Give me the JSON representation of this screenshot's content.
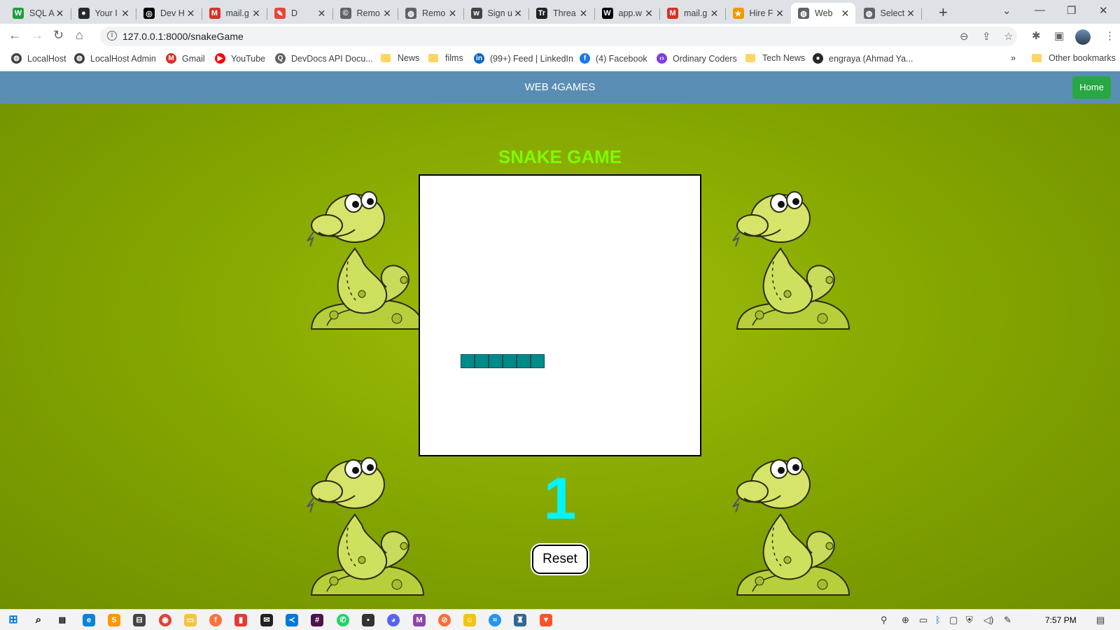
{
  "browser": {
    "tabs": [
      {
        "title": "SQL A",
        "icon": "w-icon",
        "color": "#1e9e3e",
        "glyph": "W"
      },
      {
        "title": "Your I",
        "icon": "github-icon",
        "color": "#24292e",
        "glyph": "●"
      },
      {
        "title": "Dev H",
        "icon": "dev-icon",
        "color": "#000000",
        "glyph": "◎"
      },
      {
        "title": "mail.g",
        "icon": "gmail-icon",
        "color": "#d93025",
        "glyph": "M"
      },
      {
        "title": "D",
        "icon": "candy-icon",
        "color": "#e8453c",
        "glyph": "✎"
      },
      {
        "title": "Remo",
        "icon": "remote-icon",
        "color": "#5f6368",
        "glyph": "©"
      },
      {
        "title": "Remo",
        "icon": "globe-icon",
        "color": "#5f6368",
        "glyph": "◍"
      },
      {
        "title": "Sign u",
        "icon": "w-small-icon",
        "color": "#444444",
        "glyph": "w"
      },
      {
        "title": "Threa",
        "icon": "tr-icon",
        "color": "#222222",
        "glyph": "Tr"
      },
      {
        "title": "app.w",
        "icon": "wikipedia-icon",
        "color": "#000000",
        "glyph": "W"
      },
      {
        "title": "mail.g",
        "icon": "gmail-icon",
        "color": "#d93025",
        "glyph": "M"
      },
      {
        "title": "Hire F",
        "icon": "star-icon",
        "color": "#f29900",
        "glyph": "★"
      },
      {
        "title": "Web",
        "icon": "globe-icon",
        "color": "#5f6368",
        "glyph": "◍",
        "active": true
      },
      {
        "title": "Select",
        "icon": "globe-icon",
        "color": "#5f6368",
        "glyph": "◍"
      }
    ],
    "url": "127.0.0.1:8000/snakeGame",
    "bookmarks": [
      {
        "label": "LocalHost",
        "icon": "globe-icon"
      },
      {
        "label": "LocalHost Admin",
        "icon": "globe-icon"
      },
      {
        "label": "Gmail",
        "icon": "gmail-icon"
      },
      {
        "label": "YouTube",
        "icon": "youtube-icon"
      },
      {
        "label": "DevDocs API Docu...",
        "icon": "devdocs-icon"
      },
      {
        "label": "News",
        "icon": "folder-icon"
      },
      {
        "label": "films",
        "icon": "folder-icon"
      },
      {
        "label": "(99+) Feed | LinkedIn",
        "icon": "linkedin-icon"
      },
      {
        "label": "(4) Facebook",
        "icon": "facebook-icon"
      },
      {
        "label": "Ordinary Coders",
        "icon": "code-icon"
      },
      {
        "label": "Tech News",
        "icon": "folder-icon"
      },
      {
        "label": "engraya (Ahmad Ya...",
        "icon": "github-icon"
      }
    ],
    "other_bookmarks": "Other bookmarks",
    "overflow": "»"
  },
  "site": {
    "brand": "WEB 4GAMES",
    "home_label": "Home",
    "game_title": "SNAKE GAME",
    "score": "1",
    "reset_label": "Reset",
    "snake_segments": 6
  },
  "taskbar": {
    "time": "7:57 PM"
  }
}
